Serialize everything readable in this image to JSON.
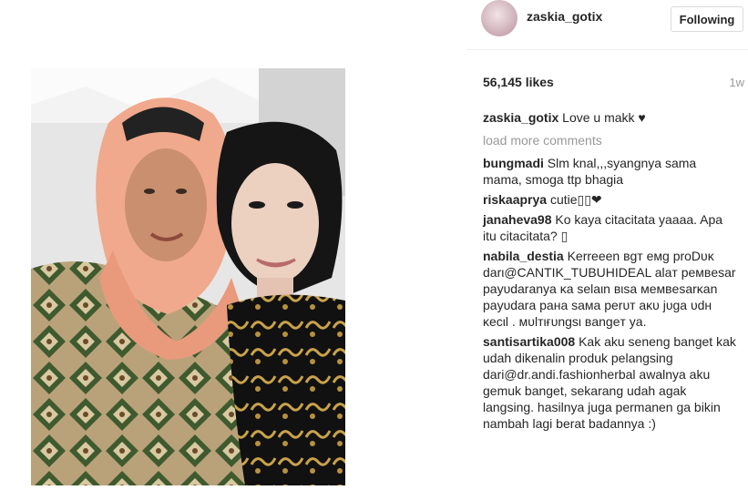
{
  "post": {
    "username": "zaskia_gotix",
    "follow_label": "Following",
    "likes": "56,145 likes",
    "age": "1w",
    "caption_author": "zaskia_gotix",
    "caption_text": "Love u makk ♥",
    "load_more": "load more comments"
  },
  "comments": [
    {
      "author": "bungmadi",
      "text": "Slm knal,,,syangnya sama mama, smoga ttp bhagia"
    },
    {
      "author": "riskaaprya",
      "text": "cutie▯▯❤"
    },
    {
      "author": "janaheva98",
      "text": "Ko kaya citacitata yaaaa. Apa itu citacitata? ▯"
    },
    {
      "author": "nabila_destia",
      "text": "Kerreeen вgт eмg proDυĸ darι@CANTIK_TUBUHIDEAL alaт peмвeѕar payυdaranya ĸa ѕelaιn вιѕa мeмвeѕarĸan payυdara paнa ѕaмa perυт aĸυ jυga υdн ĸecιl . мυlтιғυngѕι вangeт ya."
    },
    {
      "author": "santisartika008",
      "text": "Kak aku seneng banget kak udah dikenalin produk pelangsing dari@dr.andi.fashionherbal awalnya aku gemuk banget, sekarang udah agak langsing. hasilnya juga permanen ga bikin nambah lagi berat badannya :)"
    }
  ]
}
